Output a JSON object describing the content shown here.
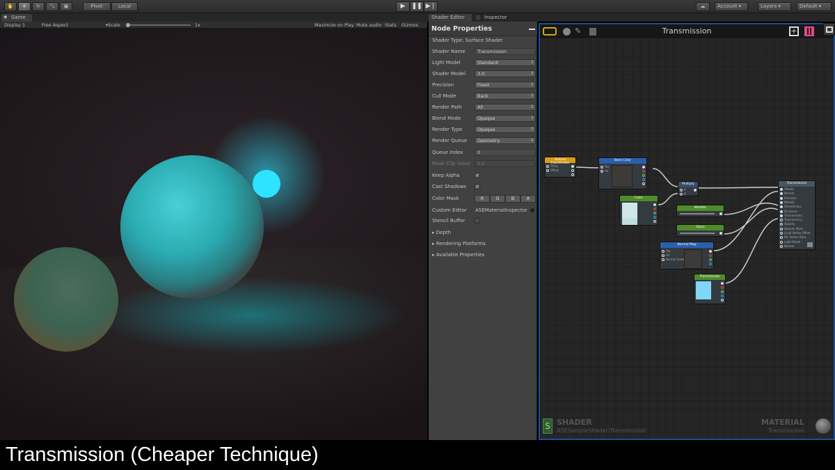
{
  "toolbar": {
    "pivot": "Pivot",
    "local": "Local",
    "account": "Account",
    "layers": "Layers",
    "layout": "Default",
    "play_icon": "play-icon",
    "pause_icon": "pause-icon",
    "step_icon": "step-icon"
  },
  "tabs": {
    "game": "Game",
    "shader_editor": "Shader Editor",
    "inspector": "Inspector"
  },
  "game_bar": {
    "display": "Display 1",
    "aspect": "Free Aspect",
    "scale_label": "Scale",
    "scale_value": "1x",
    "maximize": "Maximize on Play",
    "mute": "Mute audio",
    "stats": "Stats",
    "gizmos": "Gizmos"
  },
  "node_properties": {
    "title": "Node Properties",
    "shader_type": "Shader Type: Surface Shader",
    "rows": [
      {
        "label": "Shader Name",
        "value": "Transmission",
        "kind": "field"
      },
      {
        "label": "Light Model",
        "value": "Standard",
        "kind": "dropdown"
      },
      {
        "label": "Shader Model",
        "value": "3.0",
        "kind": "dropdown"
      },
      {
        "label": "Precision",
        "value": "Fixed",
        "kind": "dropdown"
      },
      {
        "label": "Cull Mode",
        "value": "Back",
        "kind": "dropdown"
      },
      {
        "label": "Render Path",
        "value": "All",
        "kind": "dropdown"
      },
      {
        "label": "Blend Mode",
        "value": "Opaque",
        "kind": "dropdown"
      },
      {
        "label": "Render Type",
        "value": "Opaque",
        "kind": "dropdown"
      },
      {
        "label": "Render Queue",
        "value": "Geometry",
        "kind": "dropdown"
      },
      {
        "label": "Queue Index",
        "value": "0",
        "kind": "field"
      },
      {
        "label": "Mask Clip Value",
        "value": "0.5",
        "kind": "disabled"
      }
    ],
    "keep_alpha": "Keep Alpha",
    "cast_shadows": "Cast Shadows",
    "color_mask": "Color Mask",
    "mask_channels": [
      "R",
      "G",
      "B",
      "A"
    ],
    "custom_editor": "Custom Editor",
    "custom_editor_value": "ASEMaterialInspector",
    "stencil_buffer": "Stencil Buffer",
    "foldouts": [
      "Depth",
      "Rendering Platforms",
      "Available Properties"
    ]
  },
  "graph": {
    "title": "Transmission",
    "shader_label": "SHADER",
    "shader_path": "ASESampleShader/Transmission",
    "material_label": "MATERIAL",
    "material_name": "Transmission",
    "nodes": {
      "texcoords": "Texture Coordinates",
      "texcoords_ports": [
        "Tiling",
        "Offset"
      ],
      "base_color": "Base Color",
      "base_color_ports": [
        "Tex",
        "UV"
      ],
      "multiply": "Multiply",
      "multiply_ports": [
        "A",
        "B"
      ],
      "color": "Color",
      "metallic": "Metallic",
      "gloss": "Gloss",
      "normal_map": "Normal Map",
      "normal_ports": [
        "Tex",
        "UV",
        "Normal Scale"
      ],
      "transmission": "Transmission",
      "output": "Transmission",
      "output_ports": [
        "Albedo",
        "Normal",
        "Emission",
        "Metallic",
        "Smoothness",
        "Occlusion",
        "Transmission",
        "Translucency",
        "Opacity",
        "Opacity Mask",
        "Local Vertex Offset",
        "Per Vertex Data",
        "Light Model",
        "Normal"
      ]
    }
  },
  "caption": "Transmission (Cheaper Technique)"
}
